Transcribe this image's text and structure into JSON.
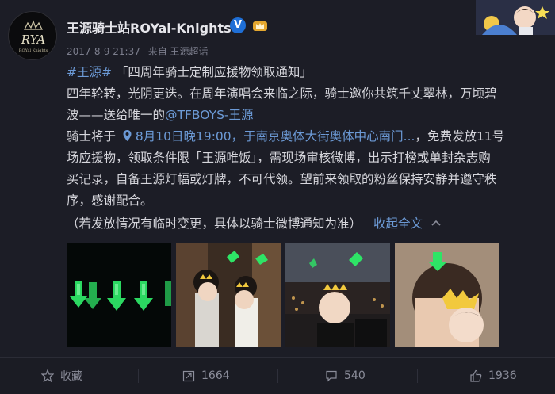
{
  "account": {
    "name": "王源骑士站ROYal-Knights",
    "avatar_text": "RYA",
    "avatar_subtext": "ROYal Knights"
  },
  "meta": {
    "time": "2017-8-9 21:37",
    "source": "来自 王源超话"
  },
  "post": {
    "tag": "#王源#",
    "title": "「四周年骑士定制应援物领取通知」",
    "line1": "四年轮转，光阴更迭。在周年演唱会来临之际，骑士邀你共筑千丈翠林，万顷碧",
    "line2_a": "波——送给唯一的",
    "mention": "@TFBOYS-王源",
    "line3_a": "骑士将于",
    "line3_location": "8月10日晚19:00，于南京奥体大街奥体中心南门...",
    "line3_b": "，免费发放11号",
    "line4": "场应援物，领取条件限「王源唯饭」，需现场审核微博，出示打榜或单封杂志购",
    "line5": "买记录，自备王源灯幅或灯牌，不可代领。望前来领取的粉丝保持安静并遵守秩",
    "line6": "序，感谢配合。",
    "line7": "（若发放情况有临时变更，具体以骑士微博通知为准）",
    "collapse": "收起全文"
  },
  "actions": {
    "favorite": "收藏",
    "repost": "1664",
    "comment": "540",
    "like": "1936"
  },
  "colors": {
    "background": "#1c1d26",
    "link": "#6c9ad6",
    "glow": "#35e06a"
  }
}
